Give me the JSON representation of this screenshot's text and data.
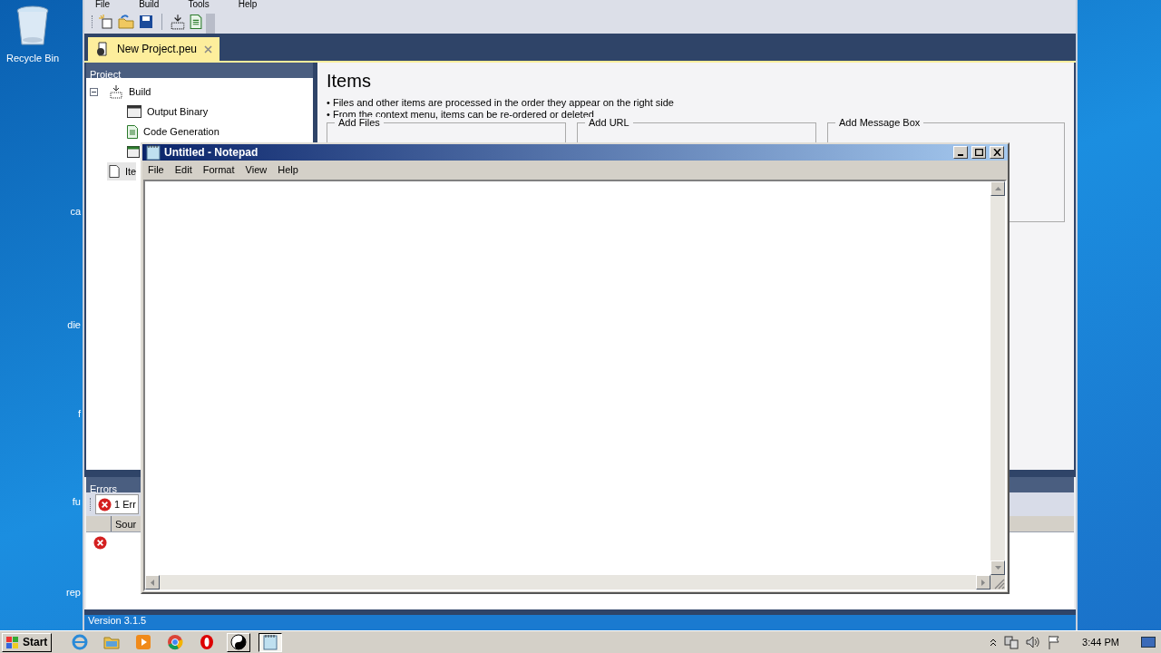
{
  "desktop": {
    "icons": [
      {
        "label": "Recycle Bin"
      }
    ],
    "partial_labels": [
      "ca",
      "die",
      "f",
      "fu",
      "rep"
    ]
  },
  "app": {
    "menu": [
      "File",
      "Build",
      "Tools",
      "Help"
    ],
    "document_tab": {
      "label": "New Project.peu",
      "selected": true
    },
    "project_panel": {
      "title": "Project",
      "tree": [
        {
          "label": "Build",
          "kind": "build",
          "expanded": true,
          "selected": false,
          "children": [
            {
              "label": "Output Binary",
              "kind": "window",
              "selected": false
            },
            {
              "label": "Code Generation",
              "kind": "doc",
              "selected": false
            },
            {
              "kind": "console",
              "selected": false
            }
          ]
        },
        {
          "label": "Ite",
          "kind": "page",
          "selected": true
        }
      ]
    },
    "content": {
      "title": "Items",
      "bullets": [
        "• Files and other items are processed in the order they appear on the right side",
        "• From the context menu, items can be re-ordered or deleted"
      ],
      "groups": [
        "Add Files",
        "Add URL",
        "Add Message Box"
      ]
    },
    "errors_panel": {
      "title": "Errors",
      "filter_button": "1 Err",
      "columns": [
        "Sour"
      ],
      "rows": [
        {
          "kind": "error"
        }
      ]
    },
    "status_bar": "Version 3.1.5"
  },
  "notepad": {
    "title": "Untitled - Notepad",
    "menu": [
      "File",
      "Edit",
      "Format",
      "View",
      "Help"
    ]
  },
  "taskbar": {
    "start": "Start",
    "apps": [
      {
        "kind": "browser",
        "open": false,
        "selected": false
      },
      {
        "kind": "folder",
        "open": false,
        "selected": false
      },
      {
        "kind": "media",
        "open": false,
        "selected": false
      },
      {
        "kind": "chrome",
        "open": false,
        "selected": false
      },
      {
        "kind": "opera",
        "open": false,
        "selected": false
      },
      {
        "kind": "yinyang",
        "open": true,
        "selected": false
      },
      {
        "kind": "notepad",
        "open": true,
        "selected": true
      }
    ],
    "clock": "3:44 PM"
  }
}
